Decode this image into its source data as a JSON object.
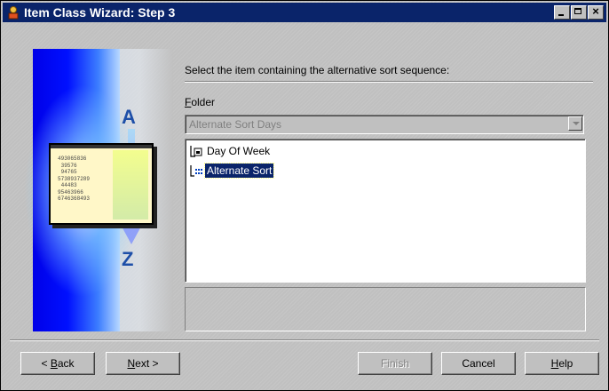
{
  "window": {
    "title": "Item Class Wizard: Step 3"
  },
  "titlebar_buttons": [
    "minimize",
    "maximize",
    "close"
  ],
  "art": {
    "letter_top": "A",
    "letter_bottom": "Z",
    "sheet_numbers": "493065836\n 39576\n 94765\n5738937289\n 44483\n95463966\n6746368493"
  },
  "main": {
    "instruction": "Select the item containing the alternative sort sequence:",
    "folder_label_mnemonic": "F",
    "folder_label_rest": "older",
    "folder_value": "Alternate Sort Days",
    "tree_items": [
      {
        "label": "Day Of Week",
        "icon": "item-icon",
        "selected": false
      },
      {
        "label": "Alternate Sort",
        "icon": "sort-item-icon",
        "selected": true
      }
    ]
  },
  "buttons": {
    "back_mn": "B",
    "back_rest": "ack",
    "back_prefix": "< ",
    "next_mn": "N",
    "next_rest": "ext >",
    "finish": "Finish",
    "cancel": "Cancel",
    "help_mn": "H",
    "help_rest": "elp"
  },
  "colors": {
    "titlebar": "#0a246a",
    "face": "#c0c0c0",
    "selection": "#0a246a",
    "art_blue": "#0010ff"
  }
}
